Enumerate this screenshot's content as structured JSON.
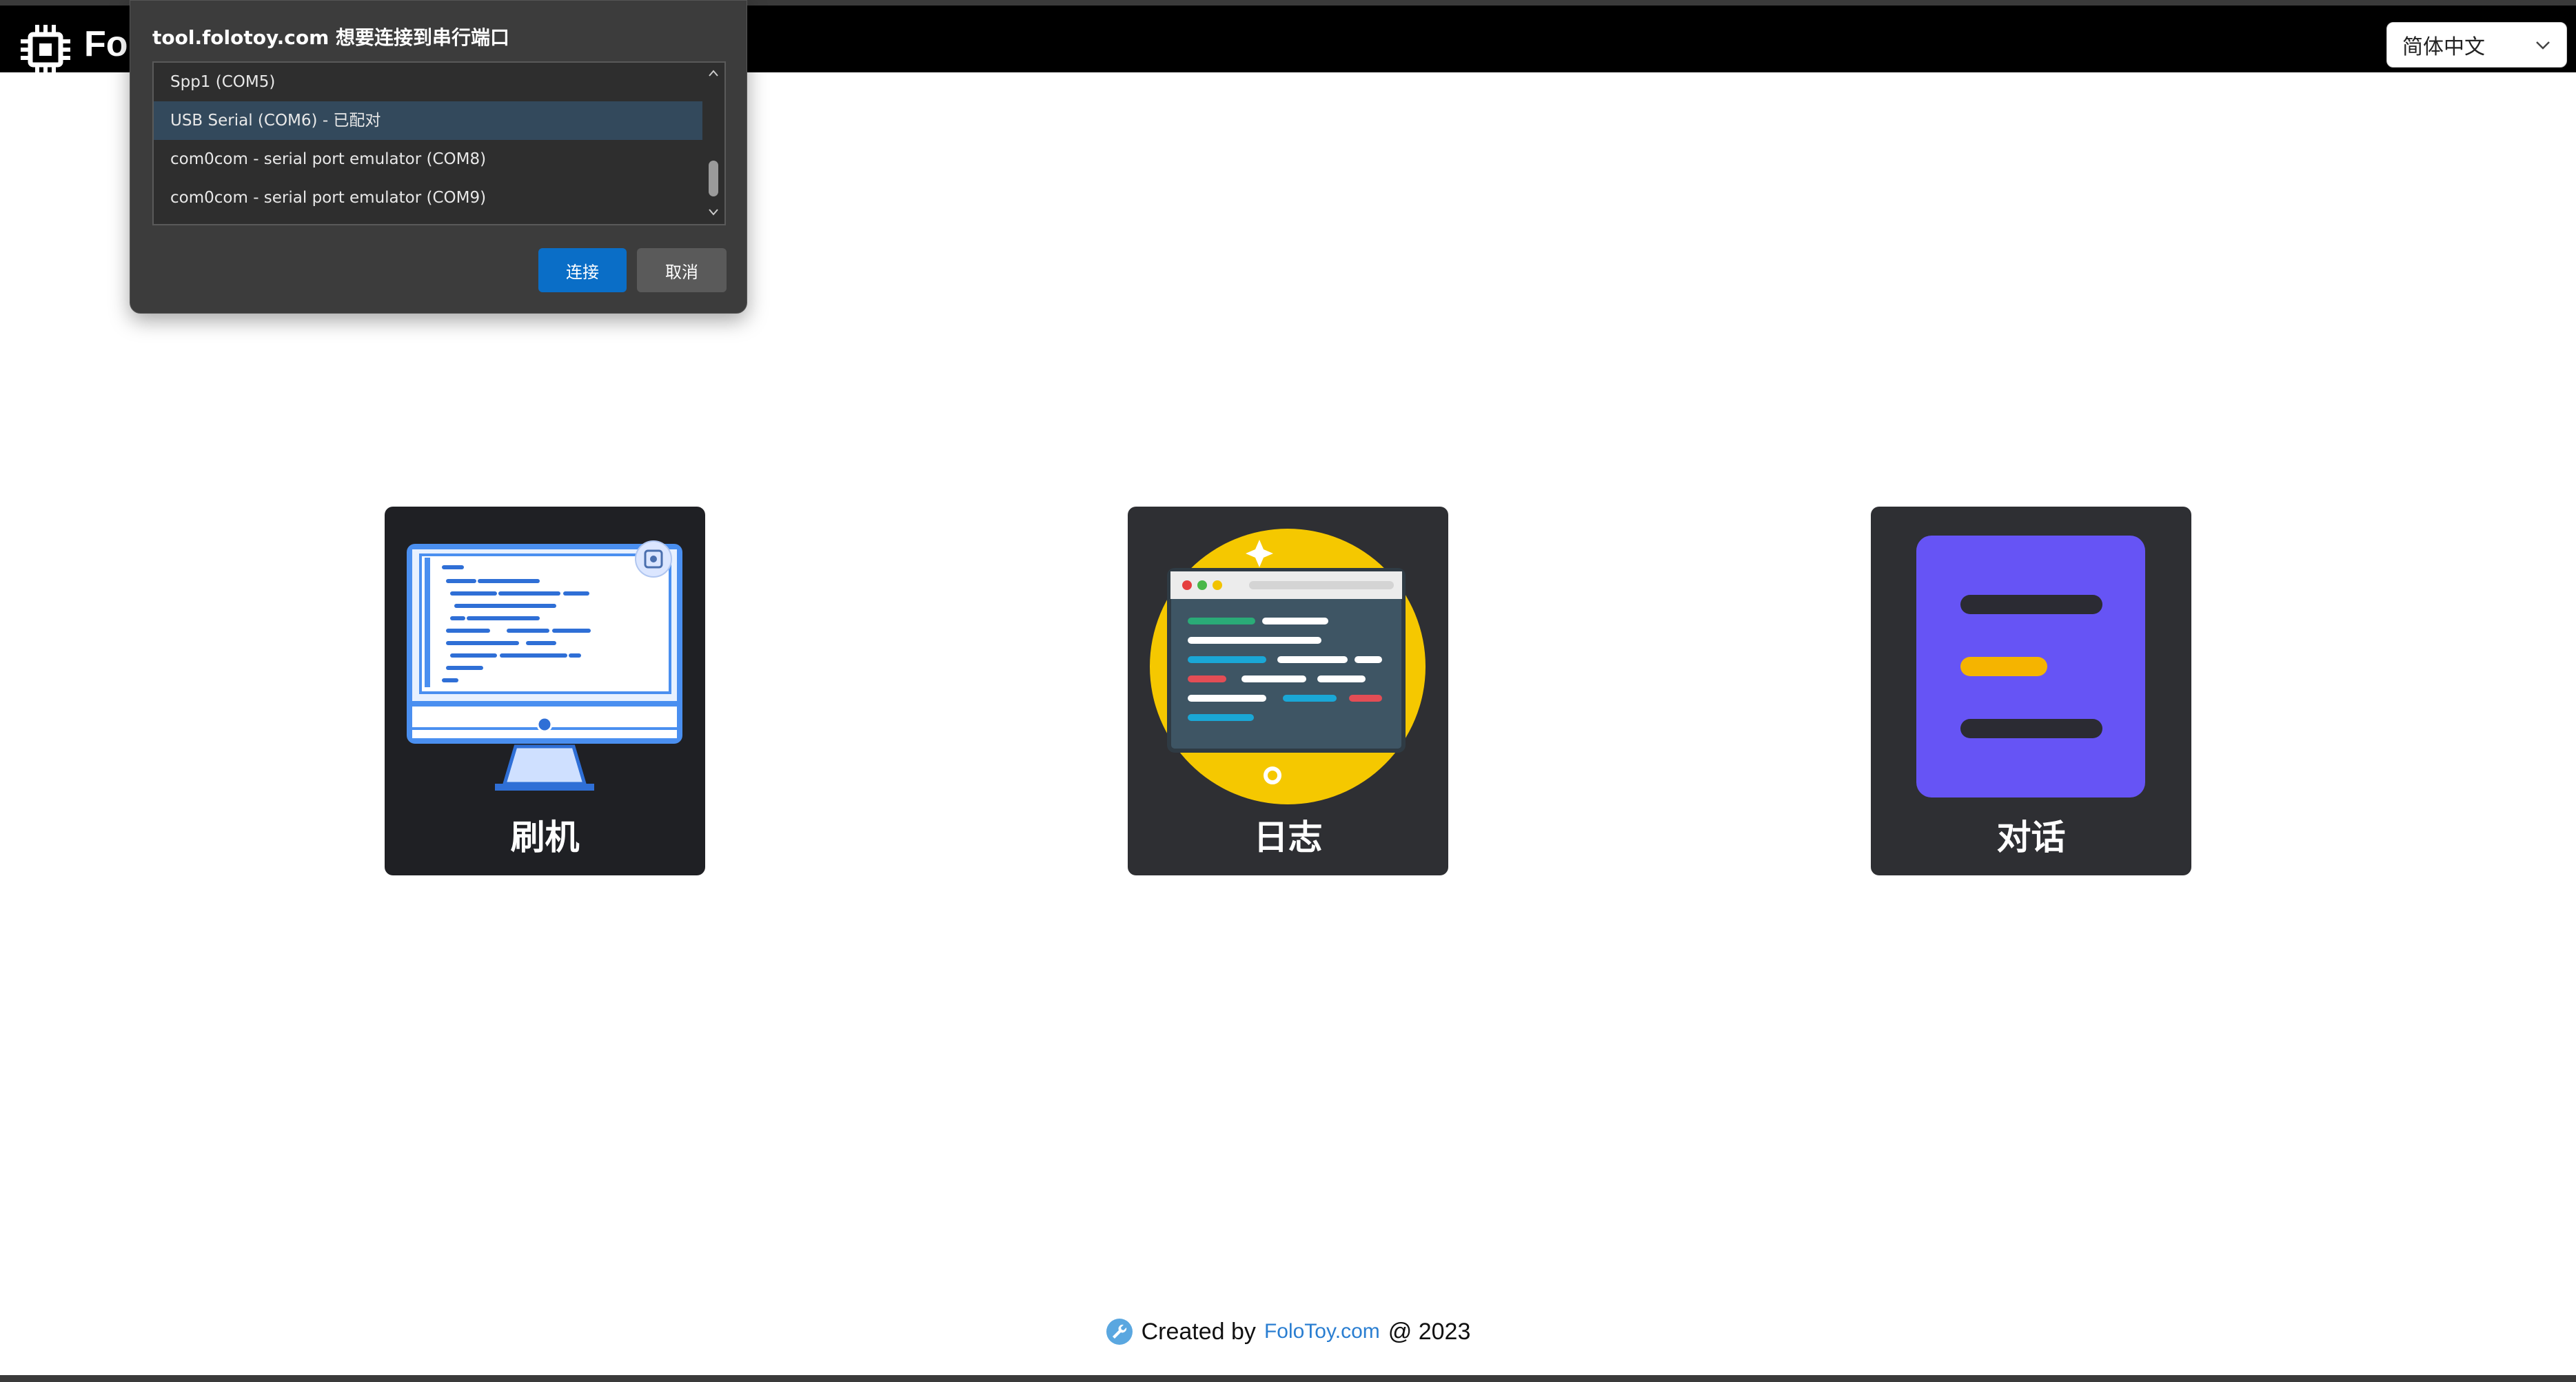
{
  "header": {
    "brand": "Fol",
    "language": "简体中文"
  },
  "dialog": {
    "title": "tool.folotoy.com 想要连接到串行端口",
    "ports": [
      "Spp1 (COM5)",
      "USB Serial (COM6) - 已配对",
      "com0com - serial port emulator (COM8)",
      "com0com - serial port emulator (COM9)"
    ],
    "selected_index": 1,
    "connect_label": "连接",
    "cancel_label": "取消"
  },
  "cards": [
    {
      "label": "刷机",
      "icon": "monitor-code-icon"
    },
    {
      "label": "日志",
      "icon": "log-window-icon"
    },
    {
      "label": "对话",
      "icon": "chat-document-icon"
    }
  ],
  "footer": {
    "prefix": "Created by",
    "link": "FoloToy.com",
    "suffix": "@ 2023",
    "icon": "wrench-icon"
  },
  "colors": {
    "topbar": "#000000",
    "dialog_bg": "#3c3c3c",
    "connect_button": "#0a6ec7",
    "link": "#2a7ed1",
    "card1_bg": "#1f2024",
    "card_bg": "#2e2f33",
    "log_circle": "#f5c800",
    "chat_bg": "#6654f5"
  }
}
